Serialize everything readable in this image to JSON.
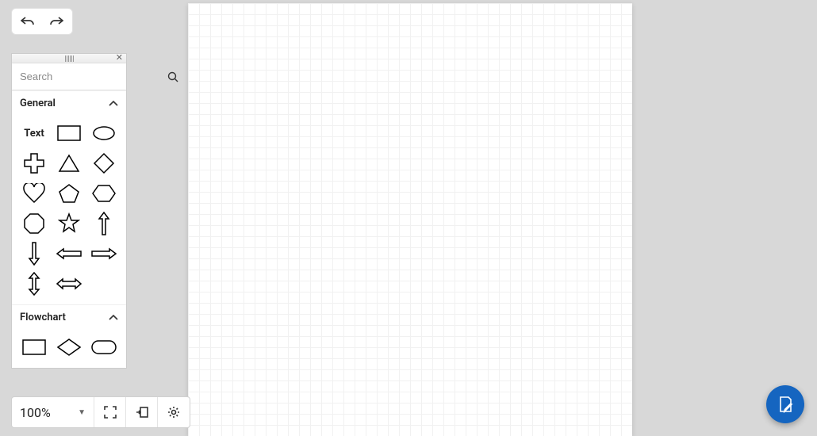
{
  "toolbar": {
    "undo_icon": "undo",
    "redo_icon": "redo"
  },
  "palette": {
    "search_placeholder": "Search",
    "sections": {
      "general": {
        "label": "General",
        "expanded": true,
        "text_shape_label": "Text"
      },
      "flowchart": {
        "label": "Flowchart",
        "expanded": true
      }
    }
  },
  "footer": {
    "zoom_value": "100%"
  }
}
